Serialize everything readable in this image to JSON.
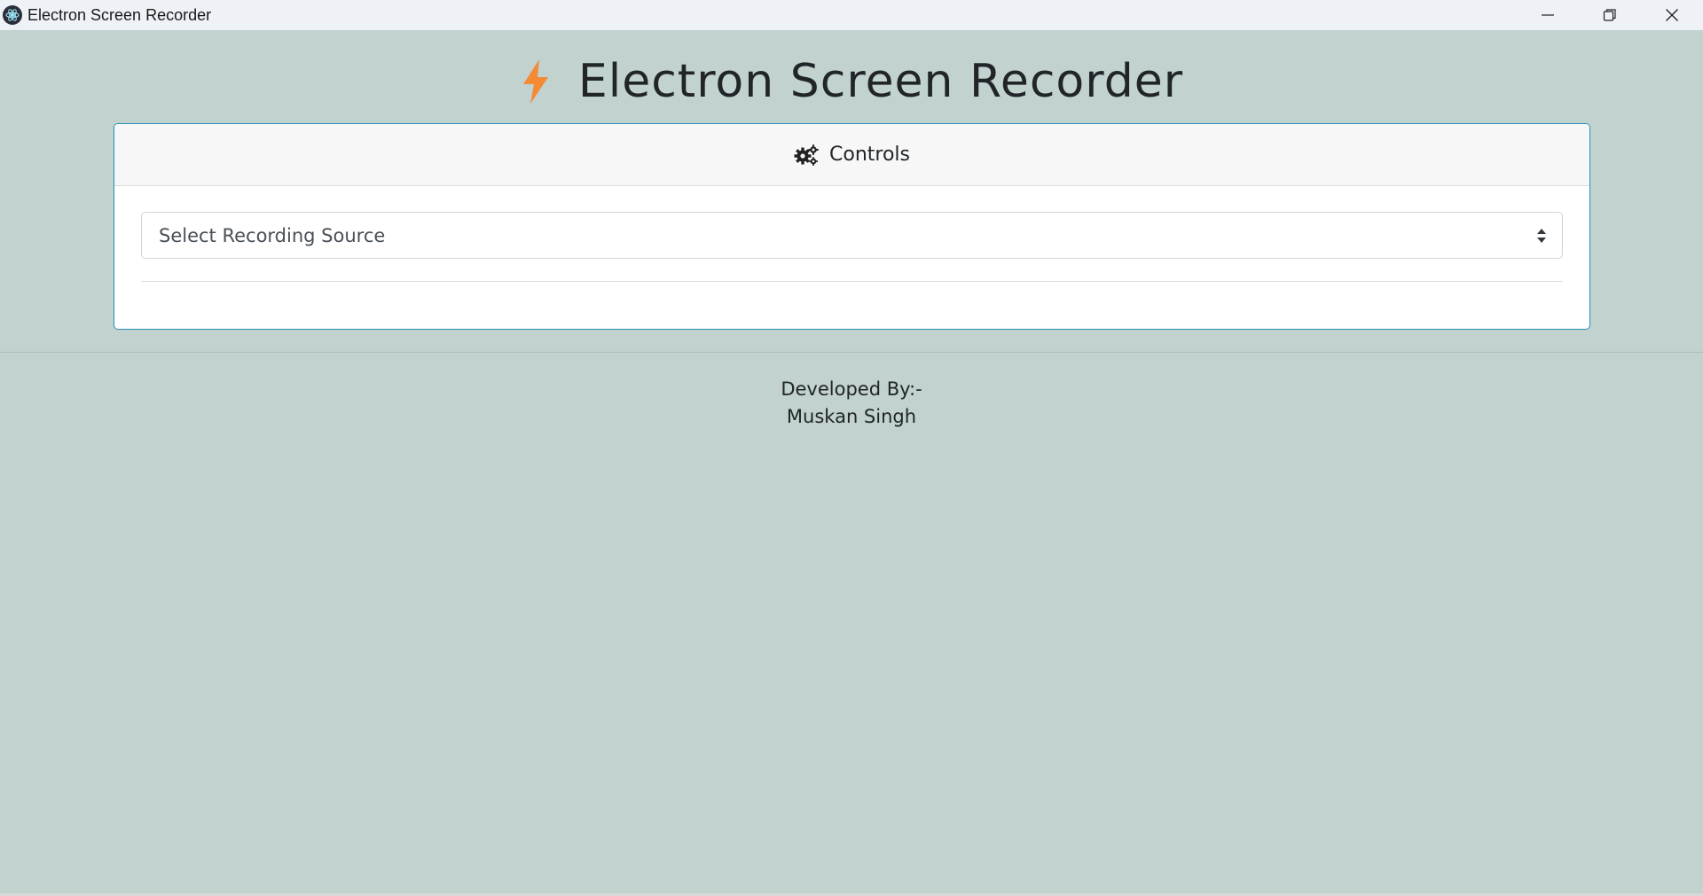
{
  "window": {
    "title": "Electron Screen Recorder",
    "controls": {
      "minimize_icon": "minimize-icon",
      "restore_icon": "restore-icon",
      "close_icon": "close-icon"
    }
  },
  "header": {
    "icon": "bolt-icon",
    "icon_color": "#f58a34",
    "title": "Electron Screen Recorder"
  },
  "controls_card": {
    "icon": "gears-icon",
    "title": "Controls",
    "border_color": "#2a8fb4",
    "source_select": {
      "selected": "Select Recording Source"
    }
  },
  "footer": {
    "line1": "Developed By:-",
    "line2": "Muskan Singh"
  },
  "colors": {
    "background": "#c1d2cf",
    "titlebar": "#eef2f6"
  }
}
